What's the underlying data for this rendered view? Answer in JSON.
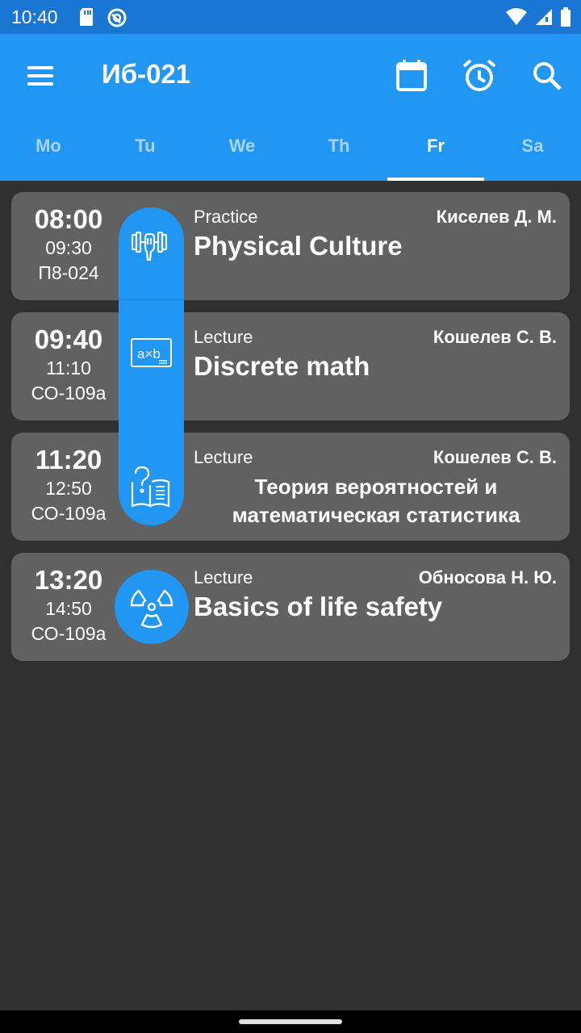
{
  "status": {
    "time": "10:40"
  },
  "appbar": {
    "title": "Иб-021"
  },
  "tabs": [
    {
      "label": "Mo"
    },
    {
      "label": "Tu"
    },
    {
      "label": "We"
    },
    {
      "label": "Th"
    },
    {
      "label": "Fr"
    },
    {
      "label": "Sa"
    }
  ],
  "classes": [
    {
      "start": "08:00",
      "end": "09:30",
      "room": "П8-024",
      "type": "Practice",
      "teacher": "Киселев Д. М.",
      "subject": "Physical Culture",
      "icon": "dumbbell-icon"
    },
    {
      "start": "09:40",
      "end": "11:10",
      "room": "СО-109а",
      "type": "Lecture",
      "teacher": "Кошелев С. В.",
      "subject": "Discrete math",
      "icon": "axb-board-icon"
    },
    {
      "start": "11:20",
      "end": "12:50",
      "room": "СО-109а",
      "type": "Lecture",
      "teacher": "Кошелев С. В.",
      "subject": "Теория вероятностей и математическая статистика",
      "icon": "question-book-icon"
    },
    {
      "start": "13:20",
      "end": "14:50",
      "room": "СО-109а",
      "type": "Lecture",
      "teacher": "Обносова Н. Ю.",
      "subject": "Basics of life safety",
      "icon": "radiation-icon"
    }
  ],
  "colors": {
    "primary": "#2196F3",
    "primary_dark": "#1976D2",
    "card": "#616161",
    "background": "#303030"
  }
}
